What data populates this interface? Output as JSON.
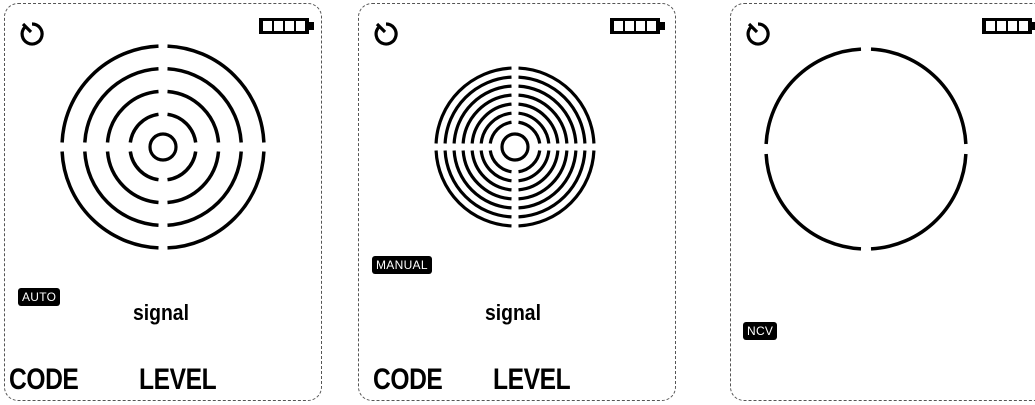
{
  "panels": [
    {
      "mode_badge": "AUTO",
      "signal_label": "signal",
      "code_label": "CODE",
      "level_label": "LEVEL",
      "target_rings": 4,
      "icons": [
        "timer-icon",
        "battery-full-icon",
        "target-icon"
      ]
    },
    {
      "mode_badge": "MANUAL",
      "signal_label": "signal",
      "code_label": "CODE",
      "level_label": "LEVEL",
      "target_rings": 7,
      "icons": [
        "timer-icon",
        "battery-full-icon",
        "target-icon"
      ]
    },
    {
      "mode_badge": "NCV",
      "target_rings": 1,
      "icons": [
        "timer-icon",
        "battery-full-icon",
        "circle-icon"
      ]
    }
  ],
  "colors": {
    "ink": "#000000",
    "background": "#ffffff",
    "border": "#555555"
  }
}
